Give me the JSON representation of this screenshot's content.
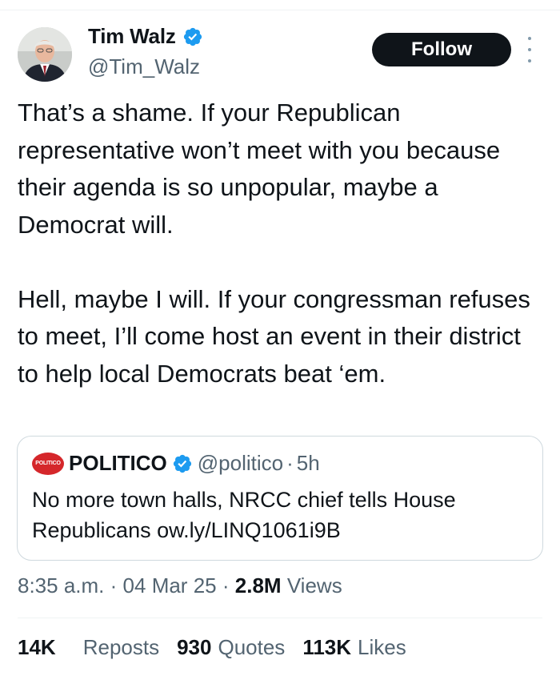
{
  "author": {
    "name": "Tim Walz",
    "handle": "@Tim_Walz",
    "verified": true
  },
  "follow_label": "Follow",
  "tweet_text": "That’s a shame. If your Republican representative won’t meet with you because their agenda is so unpopular, maybe a Democrat will.\n\nHell, maybe I will. If your congressman refuses to meet, I’ll come host an event in their district to help local Democrats beat ‘em.",
  "quoted": {
    "logo_text": "POLITICO",
    "name": "POLITICO",
    "handle": "@politico",
    "separator": "·",
    "time": "5h",
    "text": "No more town halls, NRCC chief tells House Republicans ow.ly/LINQ1061i9B"
  },
  "meta": {
    "time": "8:35 a.m.",
    "separator": "·",
    "date": "04 Mar 25",
    "views_count": "2.8M",
    "views_label": "Views"
  },
  "stats": [
    {
      "count": "14K",
      "label": "Reposts"
    },
    {
      "count": "930",
      "label": "Quotes"
    },
    {
      "count": "113K",
      "label": "Likes"
    }
  ],
  "colors": {
    "verified_blue": "#1d9bf0",
    "politico_red": "#d5272b",
    "secondary_text": "#536471",
    "button_dark": "#0f1419"
  },
  "icons": [
    "verified-badge-icon",
    "more-options-icon"
  ]
}
